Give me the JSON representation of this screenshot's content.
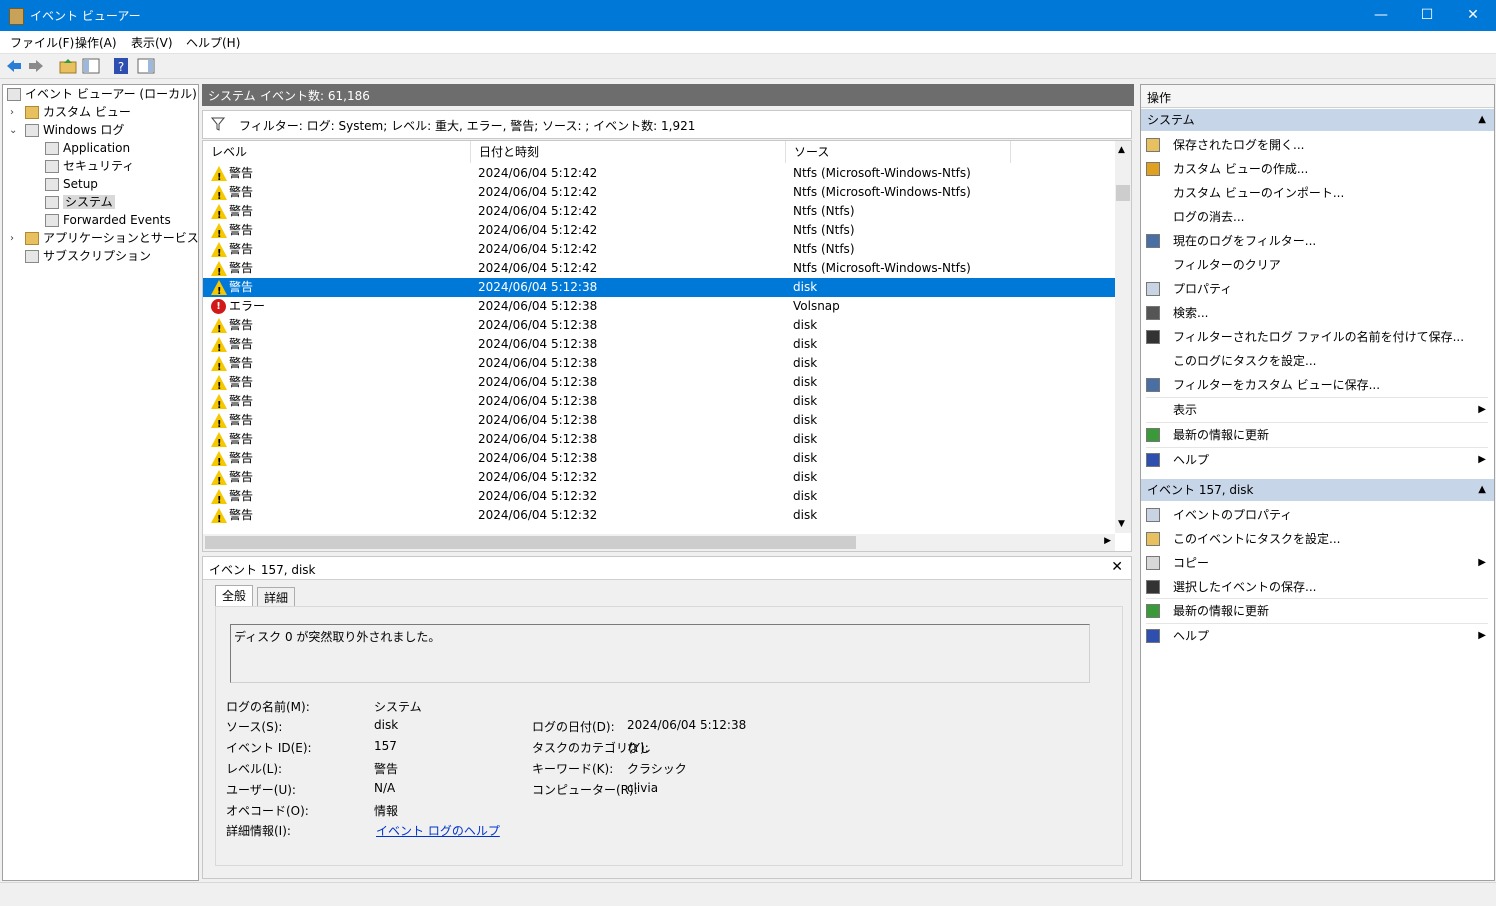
{
  "window": {
    "title": "イベント ビューアー",
    "minimize": "—",
    "maximize": "☐",
    "close": "✕"
  },
  "menu": [
    "ファイル(F)",
    "操作(A)",
    "表示(V)",
    "ヘルプ(H)"
  ],
  "tree": {
    "root": "イベント ビューアー (ローカル)",
    "custom_views": "カスタム ビュー",
    "windows_logs": "Windows ログ",
    "logs": [
      "Application",
      "セキュリティ",
      "Setup",
      "システム",
      "Forwarded Events"
    ],
    "app_services": "アプリケーションとサービス ログ",
    "subscriptions": "サブスクリプション"
  },
  "center": {
    "log_name": "システム",
    "event_count": "イベント数: 61,186",
    "filter_text": "フィルター: ログ: System; レベル: 重大, エラー, 警告; ソース: ; イベント数: 1,921",
    "columns": [
      "レベル",
      "日付と時刻",
      "ソース"
    ]
  },
  "events": [
    {
      "level": "警告",
      "type": "warn",
      "datetime": "2024/06/04 5:12:42",
      "source": "Ntfs (Microsoft-Windows-Ntfs)"
    },
    {
      "level": "警告",
      "type": "warn",
      "datetime": "2024/06/04 5:12:42",
      "source": "Ntfs (Microsoft-Windows-Ntfs)"
    },
    {
      "level": "警告",
      "type": "warn",
      "datetime": "2024/06/04 5:12:42",
      "source": "Ntfs (Ntfs)"
    },
    {
      "level": "警告",
      "type": "warn",
      "datetime": "2024/06/04 5:12:42",
      "source": "Ntfs (Ntfs)"
    },
    {
      "level": "警告",
      "type": "warn",
      "datetime": "2024/06/04 5:12:42",
      "source": "Ntfs (Ntfs)"
    },
    {
      "level": "警告",
      "type": "warn",
      "datetime": "2024/06/04 5:12:42",
      "source": "Ntfs (Microsoft-Windows-Ntfs)"
    },
    {
      "level": "警告",
      "type": "warn",
      "datetime": "2024/06/04 5:12:38",
      "source": "disk",
      "selected": true
    },
    {
      "level": "エラー",
      "type": "err",
      "datetime": "2024/06/04 5:12:38",
      "source": "Volsnap"
    },
    {
      "level": "警告",
      "type": "warn",
      "datetime": "2024/06/04 5:12:38",
      "source": "disk"
    },
    {
      "level": "警告",
      "type": "warn",
      "datetime": "2024/06/04 5:12:38",
      "source": "disk"
    },
    {
      "level": "警告",
      "type": "warn",
      "datetime": "2024/06/04 5:12:38",
      "source": "disk"
    },
    {
      "level": "警告",
      "type": "warn",
      "datetime": "2024/06/04 5:12:38",
      "source": "disk"
    },
    {
      "level": "警告",
      "type": "warn",
      "datetime": "2024/06/04 5:12:38",
      "source": "disk"
    },
    {
      "level": "警告",
      "type": "warn",
      "datetime": "2024/06/04 5:12:38",
      "source": "disk"
    },
    {
      "level": "警告",
      "type": "warn",
      "datetime": "2024/06/04 5:12:38",
      "source": "disk"
    },
    {
      "level": "警告",
      "type": "warn",
      "datetime": "2024/06/04 5:12:38",
      "source": "disk"
    },
    {
      "level": "警告",
      "type": "warn",
      "datetime": "2024/06/04 5:12:32",
      "source": "disk"
    },
    {
      "level": "警告",
      "type": "warn",
      "datetime": "2024/06/04 5:12:32",
      "source": "disk"
    },
    {
      "level": "警告",
      "type": "warn",
      "datetime": "2024/06/04 5:12:32",
      "source": "disk"
    }
  ],
  "detail": {
    "title": "イベント 157, disk",
    "tabs": [
      "全般",
      "詳細"
    ],
    "message": "ディスク 0 が突然取り外されました。",
    "log_name_label": "ログの名前(M):",
    "log_name": "システム",
    "source_label": "ソース(S):",
    "source": "disk",
    "logged_label": "ログの日付(D):",
    "logged": "2024/06/04 5:12:38",
    "event_id_label": "イベント ID(E):",
    "event_id": "157",
    "task_label": "タスクのカテゴリ(Y):",
    "task": "なし",
    "level_label": "レベル(L):",
    "level": "警告",
    "keywords_label": "キーワード(K):",
    "keywords": "クラシック",
    "user_label": "ユーザー(U):",
    "user": "N/A",
    "computer_label": "コンピューター(R):",
    "computer": "clivia",
    "opcode_label": "オペコード(O):",
    "opcode": "情報",
    "more_info_label": "詳細情報(I):",
    "more_info_link": "イベント ログのヘルプ"
  },
  "actions": {
    "title": "操作",
    "section1": "システム",
    "items1": [
      "保存されたログを開く...",
      "カスタム ビューの作成...",
      "カスタム ビューのインポート...",
      "ログの消去...",
      "現在のログをフィルター...",
      "フィルターのクリア",
      "プロパティ",
      "検索...",
      "フィルターされたログ ファイルの名前を付けて保存...",
      "このログにタスクを設定...",
      "フィルターをカスタム ビューに保存...",
      "表示",
      "最新の情報に更新",
      "ヘルプ"
    ],
    "section2": "イベント 157, disk",
    "items2": [
      "イベントのプロパティ",
      "このイベントにタスクを設定...",
      "コピー",
      "選択したイベントの保存...",
      "最新の情報に更新",
      "ヘルプ"
    ]
  }
}
